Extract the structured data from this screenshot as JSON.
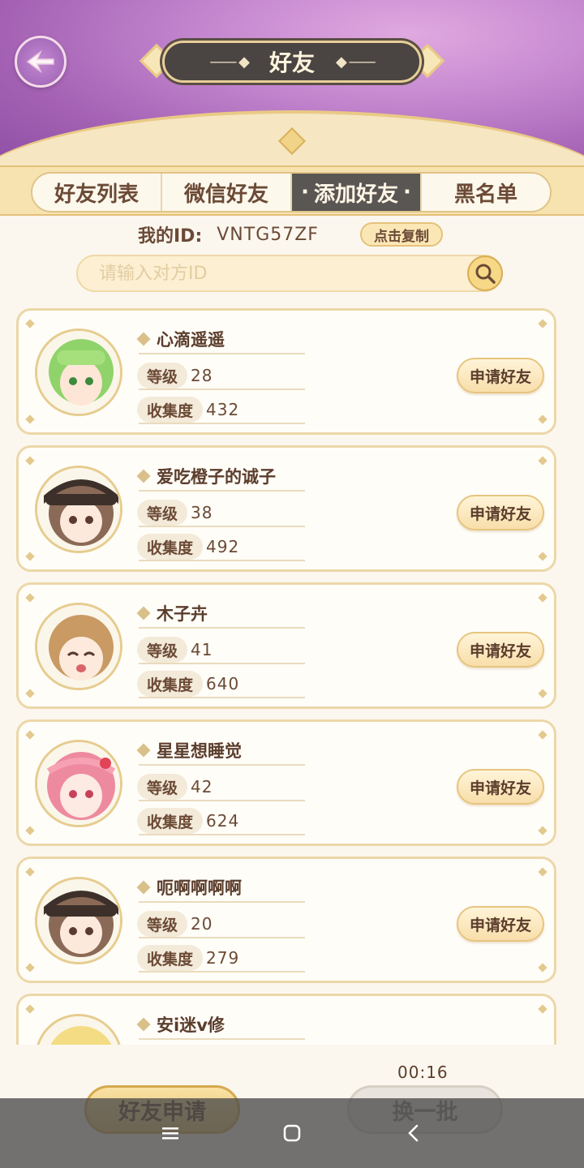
{
  "header": {
    "title": "好友"
  },
  "tabs": [
    {
      "label": "好友列表",
      "active": false
    },
    {
      "label": "微信好友",
      "active": false
    },
    {
      "label": "添加好友",
      "active": true
    },
    {
      "label": "黑名单",
      "active": false
    }
  ],
  "my_id": {
    "label": "我的ID:",
    "value": "VNTG57ZF",
    "copy_label": "点击复制"
  },
  "search": {
    "placeholder": "请输入对方ID",
    "value": ""
  },
  "stat_labels": {
    "level": "等级",
    "collection": "收集度"
  },
  "apply_label": "申请好友",
  "users": [
    {
      "name": "心滴遥遥",
      "level": "28",
      "collection": "432",
      "avatar_color": "#8fd36a"
    },
    {
      "name": "爱吃橙子的诚子",
      "level": "38",
      "collection": "492",
      "avatar_color": "#5a4639"
    },
    {
      "name": "木子卉",
      "level": "41",
      "collection": "640",
      "avatar_color": "#c99a63"
    },
    {
      "name": "星星想睡觉",
      "level": "42",
      "collection": "624",
      "avatar_color": "#ee8aa0"
    },
    {
      "name": "呃啊啊啊啊",
      "level": "20",
      "collection": "279",
      "avatar_color": "#5a4639"
    },
    {
      "name": "安i迷v修",
      "level": "",
      "collection": "",
      "avatar_color": "#f3dc83"
    }
  ],
  "timer": "00:16",
  "bottom": {
    "requests_label": "好友申请",
    "refresh_label": "换一批"
  },
  "colors": {
    "header_purple": "#a562b4",
    "gold": "#e6c57f",
    "active_tab": "#5a5653"
  }
}
